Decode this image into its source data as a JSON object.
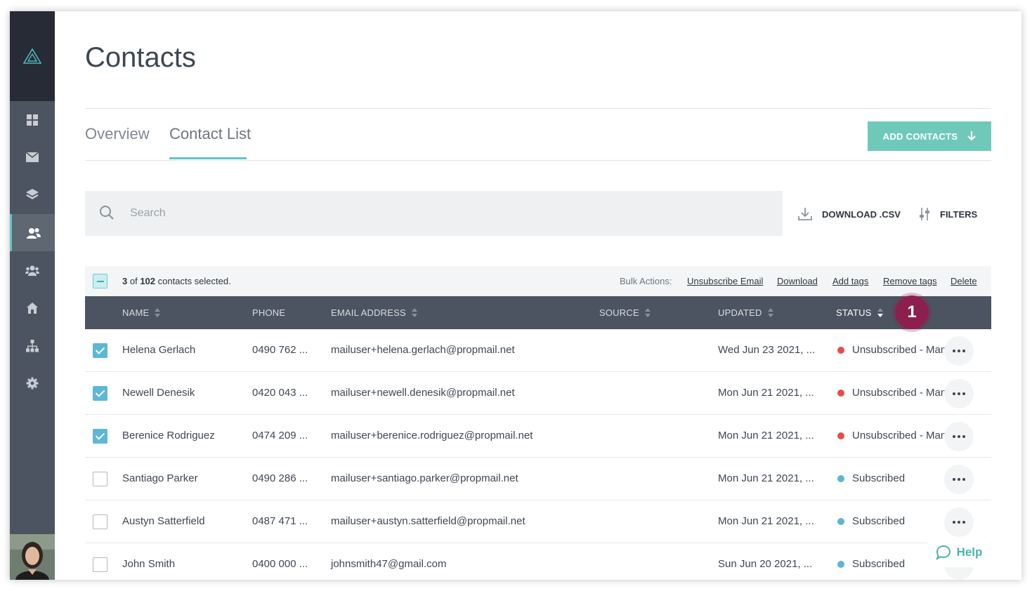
{
  "page": {
    "title": "Contacts",
    "tabs": [
      {
        "label": "Overview"
      },
      {
        "label": "Contact List"
      }
    ],
    "add_contacts_label": "ADD CONTACTS"
  },
  "search": {
    "placeholder": "Search"
  },
  "toolbar": {
    "download_label": "DOWNLOAD .CSV",
    "filters_label": "FILTERS"
  },
  "selection": {
    "selected": "3",
    "of_text": "of",
    "total": "102",
    "suffix": "contacts selected."
  },
  "bulk_actions": {
    "label": "Bulk Actions:",
    "items": [
      "Unsubscribe Email",
      "Download",
      "Add tags",
      "Remove tags",
      "Delete"
    ]
  },
  "table": {
    "columns": [
      "NAME",
      "PHONE",
      "EMAIL ADDRESS",
      "SOURCE",
      "UPDATED",
      "STATUS"
    ],
    "annotation_badge": "1",
    "rows": [
      {
        "checked": true,
        "name": "Helena Gerlach",
        "phone": "0490 762 ...",
        "email": "mailuser+helena.gerlach@propmail.net",
        "source": "",
        "updated": "Wed Jun 23 2021, ...",
        "status": "Unsubscribed - Manual",
        "status_color": "#e94b4b"
      },
      {
        "checked": true,
        "name": "Newell Denesik",
        "phone": "0420 043 ...",
        "email": "mailuser+newell.denesik@propmail.net",
        "source": "",
        "updated": "Mon Jun 21 2021, ...",
        "status": "Unsubscribed - Manual",
        "status_color": "#e94b4b"
      },
      {
        "checked": true,
        "name": "Berenice Rodriguez",
        "phone": "0474 209 ...",
        "email": "mailuser+berenice.rodriguez@propmail.net",
        "source": "",
        "updated": "Mon Jun 21 2021, ...",
        "status": "Unsubscribed - Manual",
        "status_color": "#e94b4b"
      },
      {
        "checked": false,
        "name": "Santiago Parker",
        "phone": "0490 286 ...",
        "email": "mailuser+santiago.parker@propmail.net",
        "source": "",
        "updated": "Mon Jun 21 2021, ...",
        "status": "Subscribed",
        "status_color": "#5bb6d6"
      },
      {
        "checked": false,
        "name": "Austyn Satterfield",
        "phone": "0487 471 ...",
        "email": "mailuser+austyn.satterfield@propmail.net",
        "source": "",
        "updated": "Mon Jun 21 2021, ...",
        "status": "Subscribed",
        "status_color": "#5bb6d6"
      },
      {
        "checked": false,
        "name": "John Smith",
        "phone": "0400 000 ...",
        "email": "johnsmith47@gmail.com",
        "source": "",
        "updated": "Sun Jun 20 2021, ...",
        "status": "Subscribed",
        "status_color": "#5bb6d6"
      }
    ]
  },
  "sidebar": {
    "items": [
      {
        "icon": "dashboard-grid-icon"
      },
      {
        "icon": "mail-icon"
      },
      {
        "icon": "layers-icon"
      },
      {
        "icon": "contacts-icon",
        "active": true
      },
      {
        "icon": "audience-group-icon"
      },
      {
        "icon": "home-icon"
      },
      {
        "icon": "org-chart-icon"
      },
      {
        "icon": "gear-icon"
      }
    ]
  },
  "help": {
    "label": "Help"
  },
  "colors": {
    "accent": "#62c3c8",
    "button": "#6fc9bb",
    "sidebar": "#4b5460",
    "sidebar_top": "#262b35",
    "unsubscribed": "#e94b4b",
    "subscribed": "#5bb6d6",
    "badge": "#8d1f4f"
  }
}
